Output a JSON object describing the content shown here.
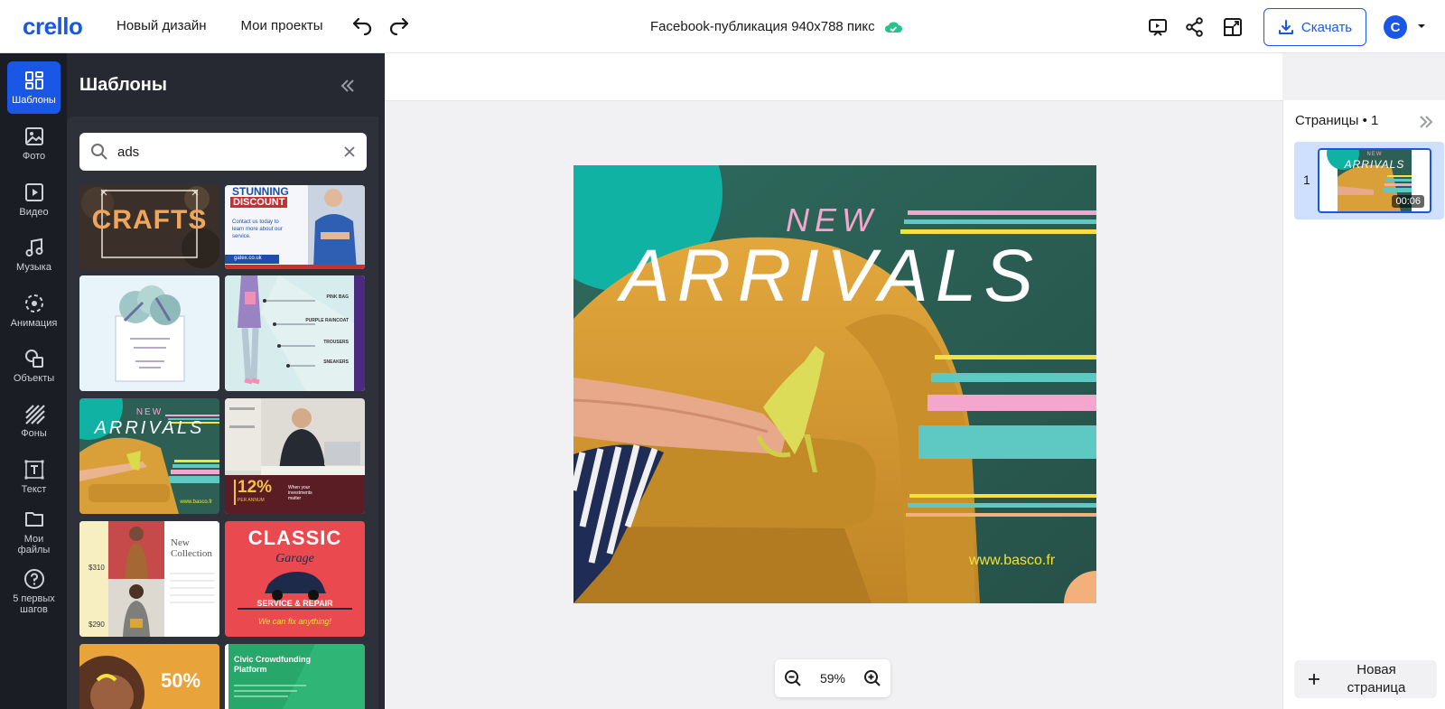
{
  "app": {
    "logo": "crello",
    "nav": [
      "Новый дизайн",
      "Мои проекты"
    ],
    "doc_title": "Facebook-публикация 940x788  пикс",
    "download_label": "Скачать",
    "avatar_letter": "C",
    "accent": "#1a57e6"
  },
  "rail": [
    {
      "label": "Шаблоны",
      "icon": "templates-icon",
      "active": true
    },
    {
      "label": "Фото",
      "icon": "photo-icon"
    },
    {
      "label": "Видео",
      "icon": "video-icon"
    },
    {
      "label": "Музыка",
      "icon": "music-icon"
    },
    {
      "label": "Анимация",
      "icon": "animation-icon"
    },
    {
      "label": "Объекты",
      "icon": "objects-icon"
    },
    {
      "label": "Фоны",
      "icon": "backgrounds-icon"
    },
    {
      "label": "Текст",
      "icon": "text-icon"
    },
    {
      "label": "Мои файлы",
      "icon": "folder-icon"
    },
    {
      "label": "5 первых шагов",
      "icon": "help-icon"
    }
  ],
  "panel": {
    "title": "Шаблоны",
    "search_value": "ads"
  },
  "templates": {
    "crafts": "CRAFTS",
    "stunning_1": "STUNNING",
    "stunning_2": "DISCOUNT",
    "stunning_body": "Contact us today to learn more about our service.",
    "stunning_url": "gatex.co.uk",
    "fashion_items": [
      "PINK BAG",
      "PURPLE RAINCOAT",
      "TROUSERS",
      "SNEAKERS"
    ],
    "arrivals_small_new": "NEW",
    "arrivals_small_title": "ARRIVALS",
    "arrivals_small_url": "www.basco.fr",
    "invest_pct": "12%",
    "invest_sub": "PER ANNUM",
    "invest_text": "When your investments matter",
    "collection_title_1": "New",
    "collection_title_2": "Collection",
    "price_1": "$310",
    "price_2": "$290",
    "classic_1": "CLASSIC",
    "classic_2": "Garage",
    "classic_3": "SERVICE & REPAIR",
    "classic_4": "We can fix anything!",
    "sale_pct": "50%",
    "civic_title": "Civic Crowdfunding Platform"
  },
  "canvas": {
    "new": "NEW",
    "title": "ARRIVALS",
    "url": "www.basco.fr",
    "colors": {
      "bg": "#2d5f55",
      "teal": "#10b3a3",
      "sofa": "#d9a03a",
      "pink": "#f4a6cf",
      "yellow": "#f3e23e",
      "mint": "#5ec9c2",
      "peach": "#f3b07a"
    }
  },
  "zoom": {
    "value": "59%"
  },
  "pages": {
    "title": "Страницы",
    "count": "• 1",
    "page_number": "1",
    "duration": "00:06",
    "new_page": "Новая страница"
  }
}
